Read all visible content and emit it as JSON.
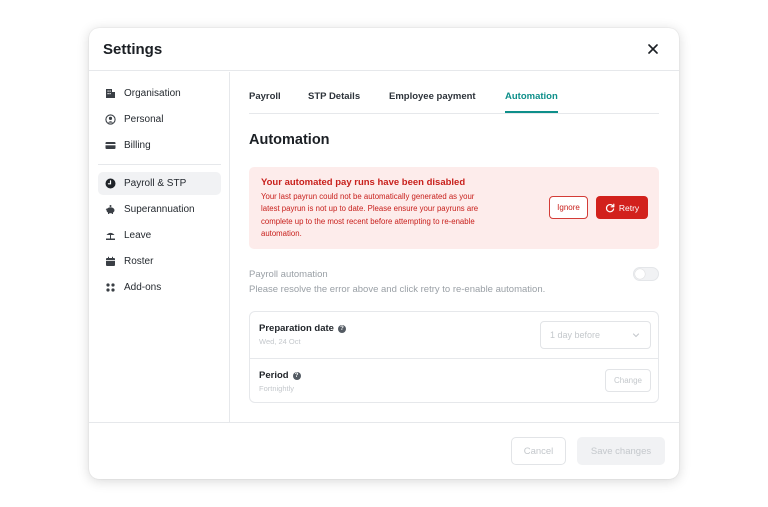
{
  "modal": {
    "title": "Settings"
  },
  "sidebar": {
    "items": [
      {
        "label": "Organisation",
        "icon": "building-icon"
      },
      {
        "label": "Personal",
        "icon": "user-circle-icon"
      },
      {
        "label": "Billing",
        "icon": "credit-card-icon"
      },
      {
        "label": "Payroll & STP",
        "icon": "clock-icon",
        "active": true
      },
      {
        "label": "Superannuation",
        "icon": "piggy-bank-icon"
      },
      {
        "label": "Leave",
        "icon": "beach-icon"
      },
      {
        "label": "Roster",
        "icon": "calendar-icon"
      },
      {
        "label": "Add-ons",
        "icon": "grid-icon"
      }
    ]
  },
  "tabs": [
    {
      "label": "Payroll"
    },
    {
      "label": "STP Details"
    },
    {
      "label": "Employee payment"
    },
    {
      "label": "Automation",
      "active": true
    }
  ],
  "section": {
    "title": "Automation"
  },
  "alert": {
    "title": "Your automated pay runs have been disabled",
    "body": "Your last payrun could not be automatically generated as your latest payrun is not up to date. Please ensure your payruns are complete up to the most recent before attempting to re-enable automation.",
    "ignore_label": "Ignore",
    "retry_label": "Retry"
  },
  "payroll_automation": {
    "label": "Payroll automation",
    "description": "Please resolve the error above and click retry to re-enable automation.",
    "enabled": false
  },
  "preparation": {
    "label": "Preparation date",
    "date": "Wed, 24 Oct",
    "select_value": "1 day before"
  },
  "period": {
    "label": "Period",
    "value": "Fortnightly",
    "change_label": "Change"
  },
  "footer": {
    "cancel_label": "Cancel",
    "save_label": "Save changes"
  },
  "colors": {
    "accent": "#0e8f8a",
    "error": "#c8201c",
    "error_bg": "#fdeceb"
  }
}
